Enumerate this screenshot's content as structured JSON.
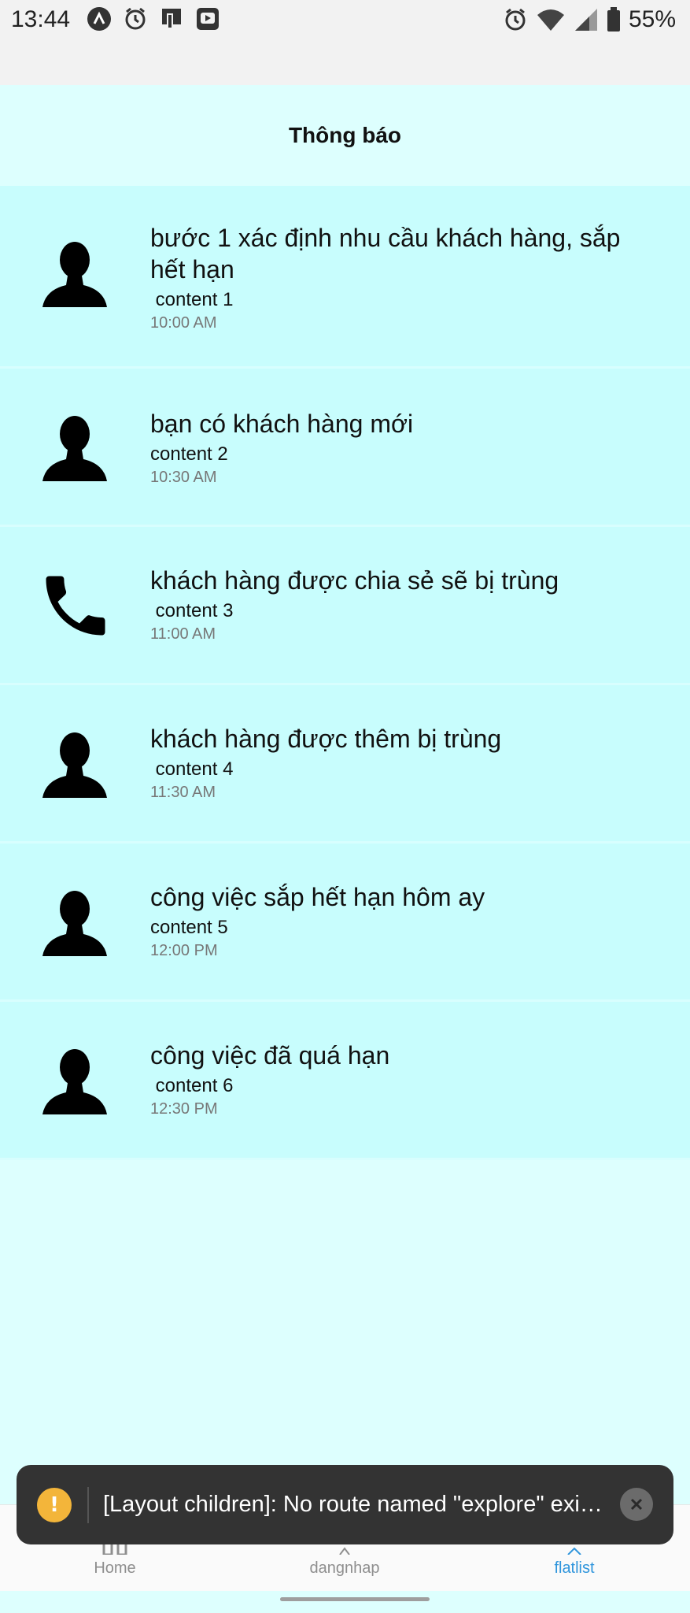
{
  "status_bar": {
    "time": "13:44",
    "battery": "55%",
    "left_icons": [
      "expo-icon",
      "alarm-icon",
      "file-icon",
      "media-icon"
    ],
    "right_icons": [
      "alarm-icon",
      "wifi-icon",
      "signal-icon",
      "battery-icon"
    ]
  },
  "header": {
    "title": "Thông báo"
  },
  "notifications": [
    {
      "icon": "person-icon",
      "title": "bước 1 xác định nhu cầu khách hàng, sắp hết hạn",
      "content": " content 1",
      "time": "10:00 AM"
    },
    {
      "icon": "person-icon",
      "title": "bạn có khách hàng mới",
      "content": "content 2",
      "time": "10:30 AM"
    },
    {
      "icon": "phone-icon",
      "title": "khách hàng được chia sẻ sẽ bị trùng",
      "content": " content 3",
      "time": "11:00 AM"
    },
    {
      "icon": "person-icon",
      "title": "khách hàng được thêm bị trùng",
      "content": " content 4",
      "time": "11:30 AM"
    },
    {
      "icon": "person-icon",
      "title": "công việc sắp hết hạn hôm ay",
      "content": "content 5",
      "time": "12:00 PM"
    },
    {
      "icon": "person-icon",
      "title": "công việc đã quá hạn",
      "content": " content 6",
      "time": "12:30 PM"
    }
  ],
  "tabs": [
    {
      "label": "Home",
      "active": false
    },
    {
      "label": "dangnhap",
      "active": false
    },
    {
      "label": "flatlist",
      "active": true
    }
  ],
  "toast": {
    "message": "[Layout children]: No route named \"explore\" exists in nested children: [\"flatlist\",\"index\",\"dangnhap\"]",
    "warn_color": "#f3b53a"
  },
  "colors": {
    "background": "#ddfffe",
    "item_background": "#c8fdfd",
    "active_tab": "#2f95dc"
  }
}
